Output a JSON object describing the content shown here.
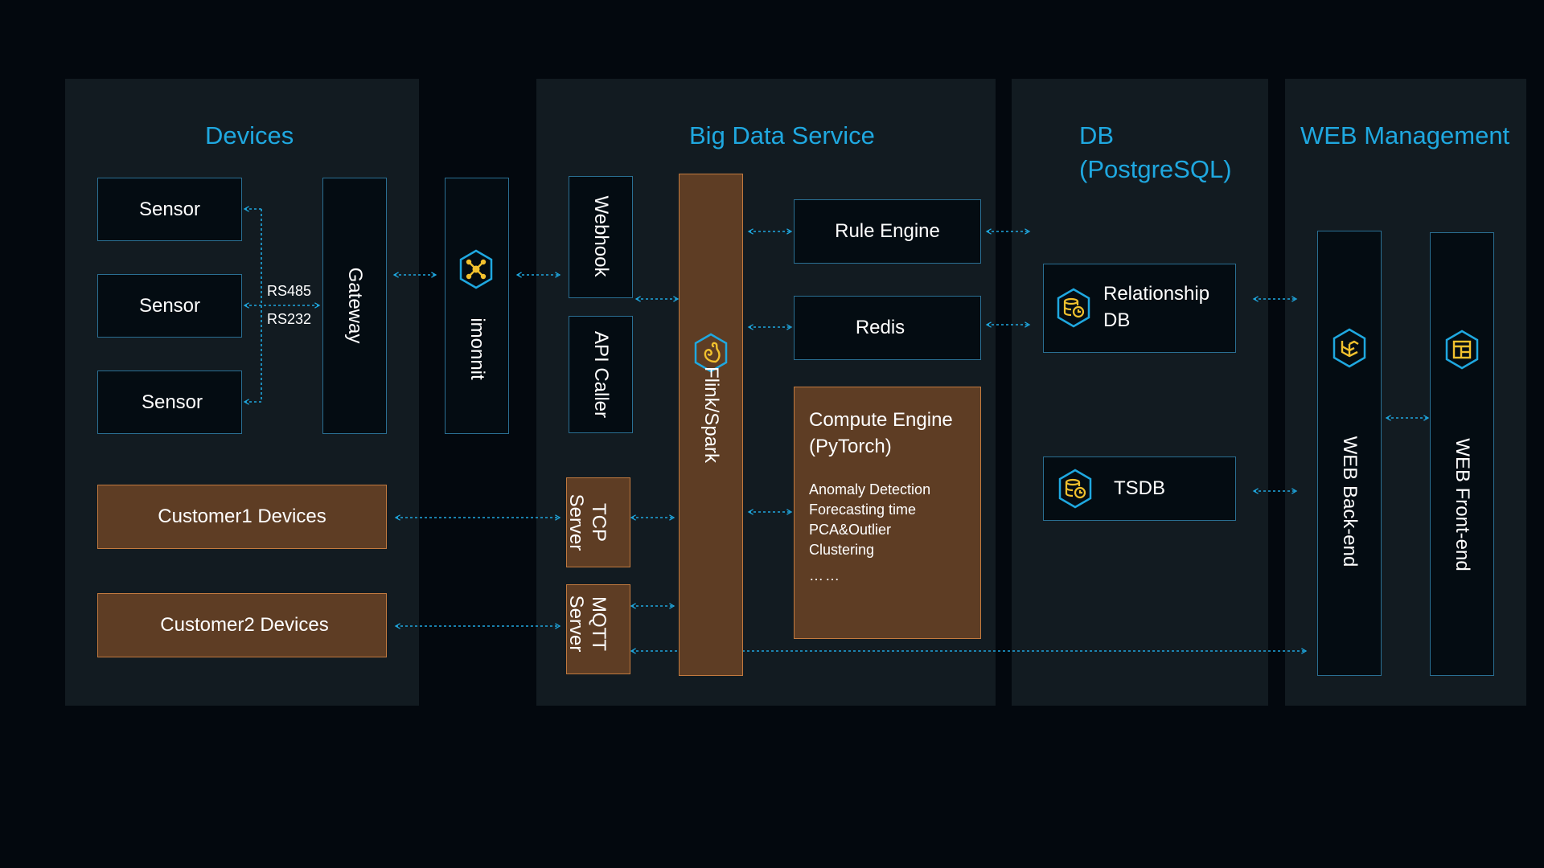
{
  "panels": {
    "devices": "Devices",
    "bigdata": "Big Data Service",
    "db_line1": "DB",
    "db_line2": "(PostgreSQL)",
    "web": "WEB Management"
  },
  "devices": {
    "sensors": [
      "Sensor",
      "Sensor",
      "Sensor"
    ],
    "rs485": "RS485",
    "rs232": "RS232",
    "gateway": "Gateway",
    "imonnit": "imonnit",
    "customer1": "Customer1 Devices",
    "customer2": "Customer2 Devices"
  },
  "bigdata": {
    "webhook": "Webhook",
    "api_caller": "API Caller",
    "tcp_line1": "TCP",
    "tcp_line2": "Server",
    "mqtt_line1": "MQTT",
    "mqtt_line2": "Server",
    "flink": "Flink/Spark",
    "rule_engine": "Rule Engine",
    "redis": "Redis",
    "compute_title_line1": "Compute Engine",
    "compute_title_line2": "(PyTorch)",
    "compute_items": [
      "Anomaly Detection",
      "Forecasting time",
      "PCA&Outlier",
      "Clustering",
      "……"
    ]
  },
  "db": {
    "relationship_line1": "Relationship",
    "relationship_line2": "DB",
    "tsdb": "TSDB"
  },
  "web": {
    "backend": "WEB Back-end",
    "frontend": "WEB Front-end"
  },
  "icons": {
    "imonnit": "network-nodes-icon",
    "flink": "squirrel-icon",
    "database": "database-clock-icon",
    "backend": "laravel-icon",
    "frontend": "layout-icon"
  },
  "colors": {
    "accent": "#1fa8e0",
    "orange_fill": "#5e3d24",
    "orange_border": "#c27a3f",
    "panel": "#121b21",
    "background": "#03080e",
    "icon_yellow": "#f2c12e"
  }
}
